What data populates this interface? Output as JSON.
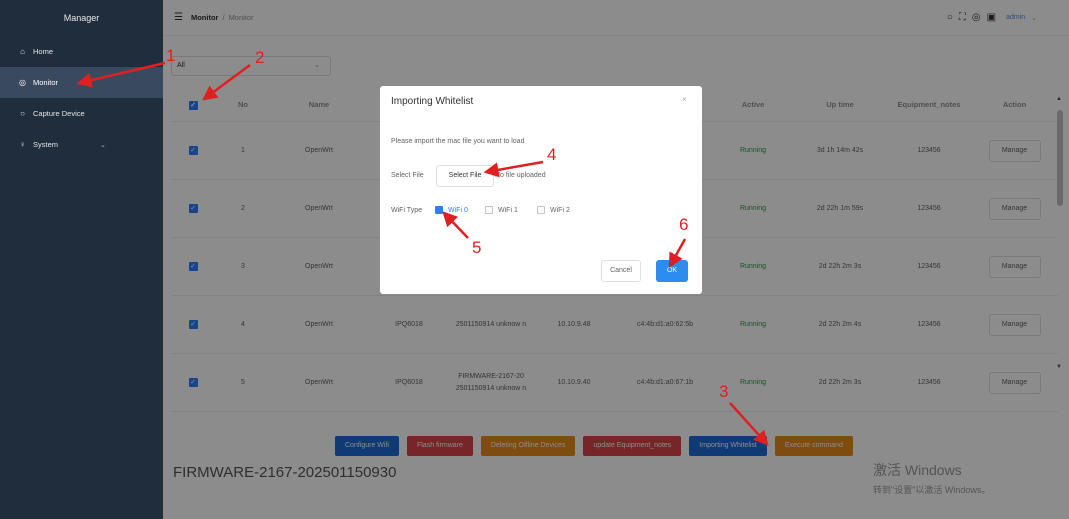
{
  "sidebar": {
    "title": "Manager",
    "items": [
      {
        "label": "Home",
        "icon": "home-icon",
        "glyph": "⌂"
      },
      {
        "label": "Monitor",
        "icon": "monitor-icon",
        "glyph": "◎"
      },
      {
        "label": "Capture Device",
        "icon": "search-icon",
        "glyph": "○"
      },
      {
        "label": "System",
        "icon": "user-icon",
        "glyph": "♀"
      }
    ]
  },
  "header": {
    "breadcrumb_parent": "Monitor",
    "breadcrumb_separator": "/",
    "breadcrumb_current": "Monitor",
    "user": "admin"
  },
  "filter": {
    "value": "All"
  },
  "table": {
    "columns": [
      "No",
      "Name",
      "Active",
      "Up time",
      "Equipment_notes",
      "Action"
    ],
    "rows": [
      {
        "no": "1",
        "name": "OpenWrt",
        "model": "",
        "firmware": "",
        "ip": "",
        "mac": "",
        "active": "Running",
        "uptime": "3d 1h 14m 42s",
        "notes": "123456",
        "action": "Manage"
      },
      {
        "no": "2",
        "name": "OpenWrt",
        "model": "",
        "firmware": "",
        "ip": "",
        "mac": "",
        "active": "Running",
        "uptime": "2d 22h 1m 59s",
        "notes": "123456",
        "action": "Manage"
      },
      {
        "no": "3",
        "name": "OpenWrt",
        "model": "",
        "firmware": "",
        "ip": "",
        "mac": "",
        "active": "Running",
        "uptime": "2d 22h 2m 3s",
        "notes": "123456",
        "action": "Manage"
      },
      {
        "no": "4",
        "name": "OpenWrt",
        "model": "IPQ6018",
        "firmware": "2501150914 unknow n",
        "ip": "10.10.9.48",
        "mac": "c4:4b:d1:a0:62:5b",
        "active": "Running",
        "uptime": "2d 22h 2m 4s",
        "notes": "123456",
        "action": "Manage"
      },
      {
        "no": "5",
        "name": "OpenWrt",
        "model": "IPQ6018",
        "firmware": "FIRMWARE-2167-20 2501150914 unknow n",
        "ip": "10.10.9.40",
        "mac": "c4:4b:d1:a0:67:1b",
        "active": "Running",
        "uptime": "2d 22h 2m 3s",
        "notes": "123456",
        "action": "Manage"
      }
    ]
  },
  "buttons": [
    "Configure Wifi",
    "Flash firmware",
    "Deleting Offline Devices",
    "update Equipment_notes",
    "Importing Whitelist",
    "Execute command"
  ],
  "firmware_label": "FIRMWARE-2167-202501150930",
  "watermark": {
    "line1": "激活 Windows",
    "line2": "转到\"设置\"以激活 Windows。"
  },
  "dialog": {
    "title": "Importing Whitelist",
    "close": "×",
    "description": "Please import the mac file you want to load",
    "select_label": "Select File",
    "select_button": "Select File",
    "file_status": "No file uploaded",
    "wifi_label": "WiFi Type",
    "wifi_options": [
      {
        "label": "WiFi 0",
        "checked": true
      },
      {
        "label": "WiFi 1",
        "checked": false
      },
      {
        "label": "WiFi 2",
        "checked": false
      }
    ],
    "cancel": "Cancel",
    "ok": "OK"
  },
  "annotations": [
    "1",
    "2",
    "3",
    "4",
    "5",
    "6"
  ],
  "colors": {
    "sidebar_bg": "#1f2d3d",
    "primary": "#2d7ff9",
    "running": "#2b9a3c",
    "annotation": "#e02020",
    "btn_red": "#d8444a",
    "btn_orange": "#e38a1a"
  }
}
